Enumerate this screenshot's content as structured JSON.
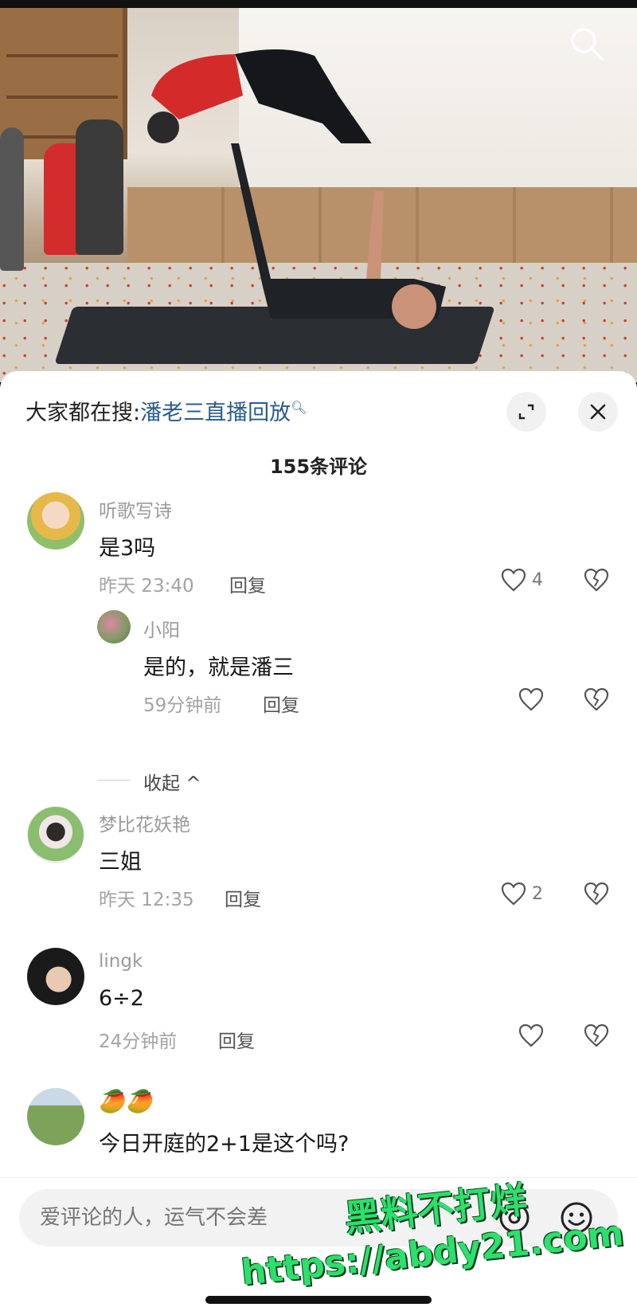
{
  "search_bar": {
    "prefix": "大家都在搜:",
    "keyword": "潘老三直播回放"
  },
  "comments_count_label": "155条评论",
  "comments": [
    {
      "username": "听歌写诗",
      "text": "是3吗",
      "time": "昨天 23:40",
      "reply_label": "回复",
      "likes": "4"
    },
    {
      "username": "梦比花妖艳",
      "text": "三姐",
      "time": "昨天 12:35",
      "reply_label": "回复",
      "likes": "2"
    },
    {
      "username": "lingk",
      "text": "6÷2",
      "time": "24分钟前",
      "reply_label": "回复",
      "likes": ""
    },
    {
      "username": "🥭🥭",
      "text": "今日开庭的2+1是这个吗?"
    }
  ],
  "reply": {
    "username": "小阳",
    "text": "是的，就是潘三",
    "time": "59分钟前",
    "reply_label": "回复",
    "likes": ""
  },
  "collapse_label": "收起 ^",
  "input": {
    "placeholder": "爱评论的人，运气不会差"
  },
  "watermark": {
    "line1": "黑料不打烊",
    "line2": "https://abdy21.com"
  },
  "colors": {
    "link": "#2a5c8e",
    "watermark": "#2be06b"
  }
}
